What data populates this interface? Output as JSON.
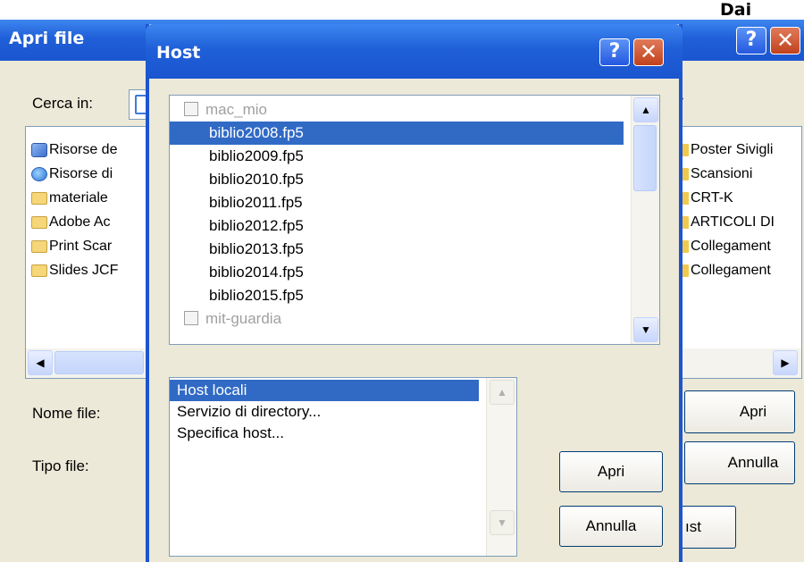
{
  "top_fragment": "Dai",
  "back_dialog": {
    "title": "Apri file",
    "look_in_label": "Cerca in:",
    "items_left": [
      {
        "label": "Risorse de",
        "icon": "computer-icon"
      },
      {
        "label": "Risorse di",
        "icon": "network-icon"
      },
      {
        "label": "materiale",
        "icon": "folder-icon"
      },
      {
        "label": "Adobe Ac",
        "icon": "folder-icon"
      },
      {
        "label": "Print Scar",
        "icon": "folder-icon"
      },
      {
        "label": "Slides JCF",
        "icon": "folder-icon"
      }
    ],
    "items_right": [
      {
        "label": "Poster Sivigli",
        "icon": "folder-icon"
      },
      {
        "label": "Scansioni",
        "icon": "folder-icon"
      },
      {
        "label": "CRT-K",
        "icon": "folder-icon"
      },
      {
        "label": "ARTICOLI DI",
        "icon": "folder-icon"
      },
      {
        "label": "Collegament",
        "icon": "shortcut-icon"
      },
      {
        "label": "Collegament",
        "icon": "folder-icon"
      }
    ],
    "file_name_label": "Nome file:",
    "file_type_label": "Tipo file:",
    "open_button": "Apri",
    "cancel_button": "Annulla",
    "host_button_fragment": "ıst"
  },
  "host_dialog": {
    "title": "Host",
    "help_glyph": "?",
    "close_glyph": "✕",
    "files": [
      {
        "label": "mac_mio",
        "type": "host",
        "selected": false
      },
      {
        "label": "biblio2008.fp5",
        "type": "file",
        "selected": true
      },
      {
        "label": "biblio2009.fp5",
        "type": "file",
        "selected": false
      },
      {
        "label": "biblio2010.fp5",
        "type": "file",
        "selected": false
      },
      {
        "label": "biblio2011.fp5",
        "type": "file",
        "selected": false
      },
      {
        "label": "biblio2012.fp5",
        "type": "file",
        "selected": false
      },
      {
        "label": "biblio2013.fp5",
        "type": "file",
        "selected": false
      },
      {
        "label": "biblio2014.fp5",
        "type": "file",
        "selected": false
      },
      {
        "label": "biblio2015.fp5",
        "type": "file",
        "selected": false
      },
      {
        "label": "mit-guardia",
        "type": "host",
        "selected": false
      }
    ],
    "sources": [
      {
        "label": "Host locali",
        "selected": true
      },
      {
        "label": "Servizio di directory...",
        "selected": false
      },
      {
        "label": "Specifica host...",
        "selected": false
      }
    ],
    "open_button": "Apri",
    "cancel_button": "Annulla"
  },
  "colors": {
    "titlebar": "#1f5fd8",
    "dialog_bg": "#ece9d8",
    "selection": "#316ac5"
  }
}
